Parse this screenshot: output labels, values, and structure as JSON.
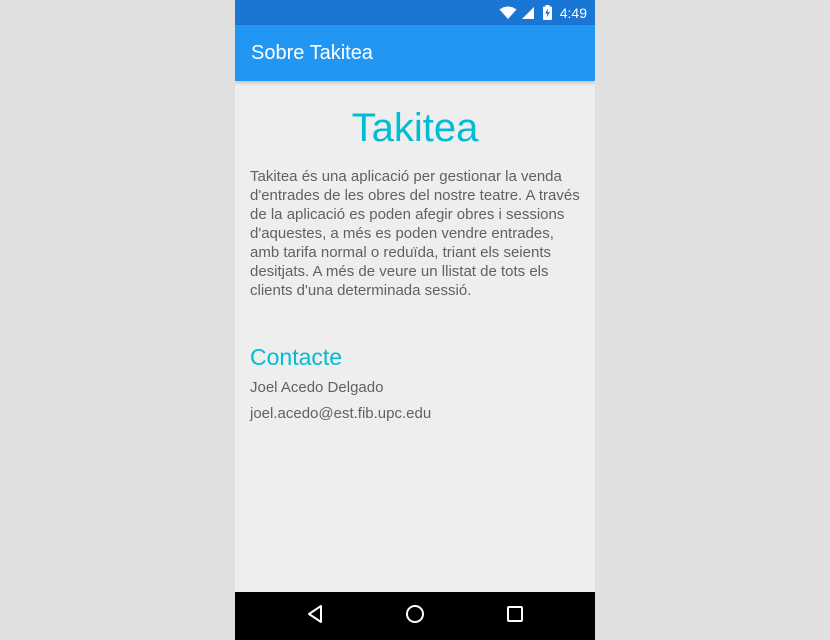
{
  "status_bar": {
    "time": "4:49",
    "icons": [
      "wifi-icon",
      "signal-icon",
      "battery-charging-icon"
    ]
  },
  "app_bar": {
    "title": "Sobre Takitea"
  },
  "main": {
    "title": "Takitea",
    "description": "Takitea és una aplicació per gestionar la venda d'entrades de les obres del nostre teatre. A través de la aplicació es poden afegir obres i sessions d'aquestes, a més es poden vendre entrades, amb tarifa normal o reduïda, triant els seients desitjats. A més de veure un llistat de tots els clients d'una determinada sessió.",
    "contact_heading": "Contacte",
    "contact_name": "Joel Acedo Delgado",
    "contact_email": "joel.acedo@est.fib.upc.edu"
  },
  "nav_bar": {
    "buttons": [
      "back-icon",
      "home-icon",
      "recents-icon"
    ]
  },
  "colors": {
    "status_bar": "#1976d2",
    "app_bar": "#2196f3",
    "accent": "#00bcd4",
    "background": "#eeeeee",
    "text": "#616161"
  }
}
